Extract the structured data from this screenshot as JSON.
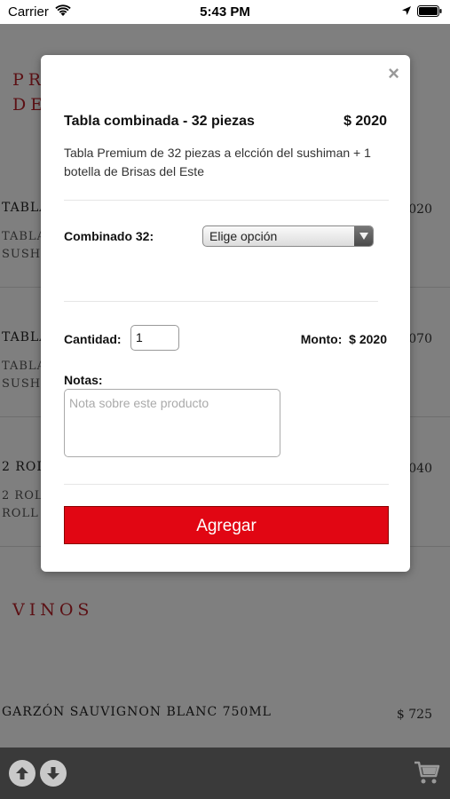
{
  "status_bar": {
    "carrier": "Carrier",
    "time": "5:43 PM"
  },
  "menu": {
    "categories": [
      {
        "label": "PR"
      },
      {
        "label": "DE"
      },
      {
        "label": "VINOS"
      }
    ],
    "items": [
      {
        "title": "TABLA",
        "desc_line1": "TABLA",
        "desc_line2": "SUSHI",
        "price": "020"
      },
      {
        "title": "TABLA",
        "desc_line1": "TABLA",
        "desc_line2": "SUSHI",
        "price": "070"
      },
      {
        "title": "2 ROL",
        "desc_line1": "2 ROL",
        "desc_line2": "ROLL",
        "price": "040"
      },
      {
        "title": "GARZÓN SAUVIGNON BLANC 750ML",
        "price": "$ 725"
      }
    ]
  },
  "modal": {
    "close_symbol": "×",
    "product_title": "Tabla combinada - 32 piezas",
    "product_price": "$ 2020",
    "description": "Tabla Premium de 32 piezas a elcción del sushiman + 1 botella de Brisas del Este",
    "option_label": "Combinado 32:",
    "option_selected": "Elige opción",
    "quantity_label": "Cantidad:",
    "quantity_value": "1",
    "amount_label": "Monto:",
    "amount_value": "$ 2020",
    "notes_label": "Notas:",
    "notes_placeholder": "Nota sobre este producto",
    "add_button": "Agregar"
  },
  "colors": {
    "accent": "#e10613",
    "category": "#b9222b",
    "bottom_bar": "#3a3a3a"
  },
  "icons": [
    "wifi-icon",
    "location-arrow-icon",
    "battery-icon",
    "close-icon",
    "chevron-down-icon",
    "arrow-up-icon",
    "arrow-down-icon",
    "cart-icon"
  ]
}
